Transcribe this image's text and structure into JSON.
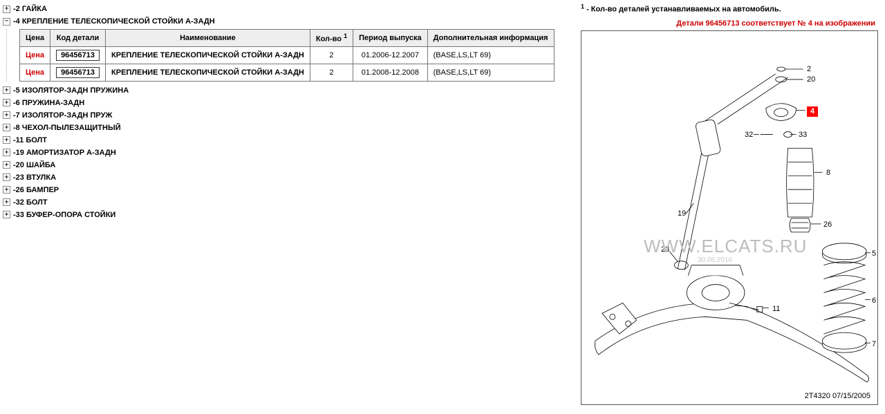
{
  "tree": [
    {
      "prefix": "-2",
      "label": "ГАЙКА",
      "expanded": false
    },
    {
      "prefix": "-4",
      "label": "КРЕПЛЕНИЕ ТЕЛЕСКОПИЧЕСКОЙ СТОЙКИ А-ЗАДН",
      "expanded": true
    },
    {
      "prefix": "-5",
      "label": "ИЗОЛЯТОР-ЗАДН ПРУЖИНА",
      "expanded": false
    },
    {
      "prefix": "-6",
      "label": "ПРУЖИНА-ЗАДН",
      "expanded": false
    },
    {
      "prefix": "-7",
      "label": "ИЗОЛЯТОР-ЗАДН ПРУЖ",
      "expanded": false
    },
    {
      "prefix": "-8",
      "label": "ЧЕХОЛ-ПЫЛЕЗАЩИТНЫЙ",
      "expanded": false
    },
    {
      "prefix": "-11",
      "label": "БОЛТ",
      "expanded": false
    },
    {
      "prefix": "-19",
      "label": "АМОРТИЗАТОР А-ЗАДН",
      "expanded": false
    },
    {
      "prefix": "-20",
      "label": "ШАЙБА",
      "expanded": false
    },
    {
      "prefix": "-23",
      "label": "ВТУЛКА",
      "expanded": false
    },
    {
      "prefix": "-26",
      "label": "БАМПЕР",
      "expanded": false
    },
    {
      "prefix": "-32",
      "label": "БОЛТ",
      "expanded": false
    },
    {
      "prefix": "-33",
      "label": "БУФЕР-ОПОРА СТОЙКИ",
      "expanded": false
    }
  ],
  "table": {
    "headers": {
      "price": "Цена",
      "code": "Код детали",
      "name": "Наименование",
      "qty": "Кол-во",
      "sup": "1",
      "period": "Период выпуска",
      "info": "Дополнительная информация"
    },
    "rows": [
      {
        "price": "Цена",
        "code": "96456713",
        "name": "КРЕПЛЕНИЕ ТЕЛЕСКОПИЧЕСКОЙ СТОЙКИ А-ЗАДН",
        "qty": "2",
        "period": "01.2006-12.2007",
        "info": "(BASE,LS,LT 69)"
      },
      {
        "price": "Цена",
        "code": "96456713",
        "name": "КРЕПЛЕНИЕ ТЕЛЕСКОПИЧЕСКОЙ СТОЙКИ А-ЗАДН",
        "qty": "2",
        "period": "01.2008-12.2008",
        "info": "(BASE,LS,LT 69)"
      }
    ]
  },
  "legend": {
    "sup": "1",
    "text": " - Кол-во деталей устанавливаемых на автомобиль.",
    "red": "Детали 96456713 соответствует № 4 на изображении"
  },
  "diagram": {
    "marker": "4",
    "callouts": [
      "2",
      "20",
      "4",
      "33",
      "32",
      "8",
      "19",
      "26",
      "23",
      "11",
      "5",
      "6",
      "7"
    ],
    "watermark": "WWW.ELCATS.RU",
    "watermark_date": "30.06.2016",
    "bottom_label": "2T4320  07/15/2005"
  },
  "icons": {
    "plus": "+",
    "minus": "−"
  }
}
